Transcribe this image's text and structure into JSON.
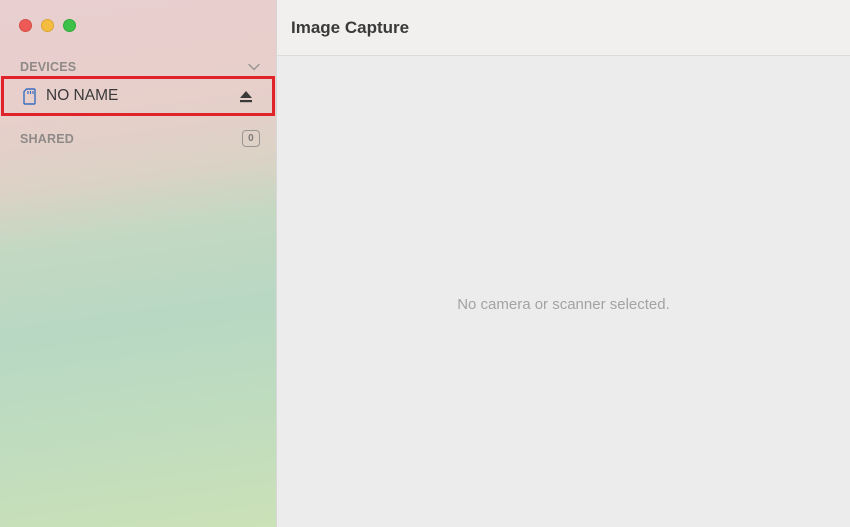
{
  "window": {
    "title": "Image Capture"
  },
  "sidebar": {
    "devices_header": "DEVICES",
    "devices": [
      {
        "label": "NO NAME",
        "icon": "sd-card-icon",
        "selected_outline_color": "#e0232b"
      }
    ],
    "shared_header": "SHARED",
    "shared_count": "0"
  },
  "main": {
    "empty_message": "No camera or scanner selected."
  },
  "colors": {
    "close": "#ee5b56",
    "minimize": "#f5bd3f",
    "maximize": "#3ec148",
    "device_icon": "#3a6fc0"
  }
}
